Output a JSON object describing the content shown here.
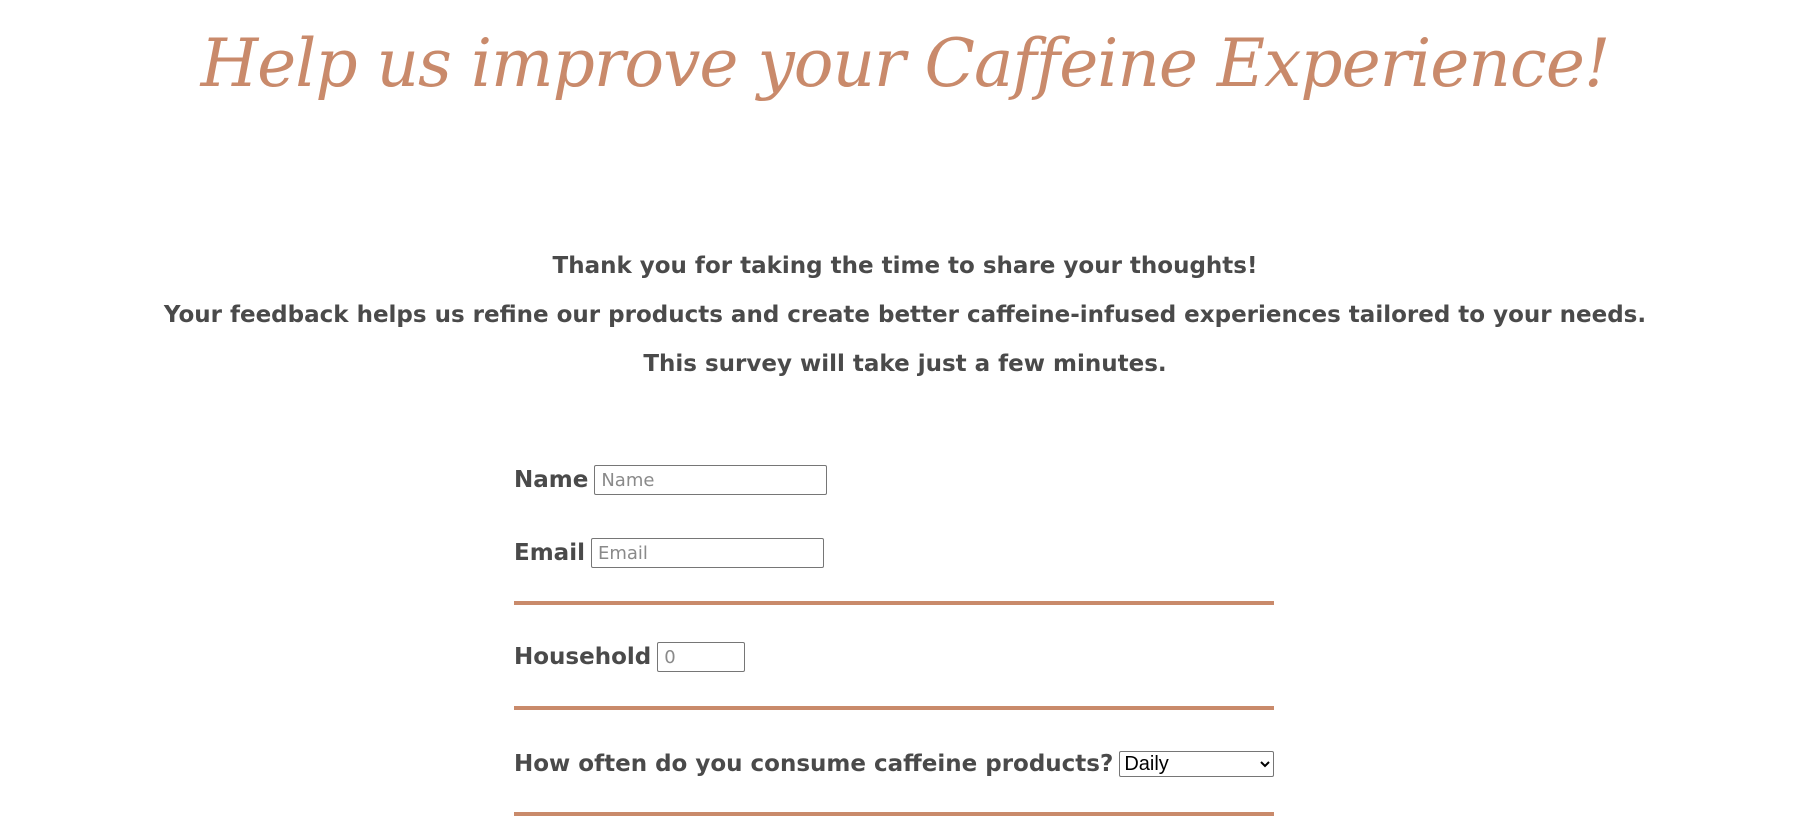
{
  "page": {
    "title": "Help us improve your Caffeine Experience!",
    "accent_color": "#c98a6b",
    "text_color": "#4a4a4a"
  },
  "intro": {
    "line1": "Thank you for taking the time to share your thoughts!",
    "line2": "Your feedback helps us refine our products and create better caffeine-infused experiences tailored to your needs.",
    "line3": "This survey will take just a few minutes."
  },
  "form": {
    "name": {
      "label": "Name",
      "value": "",
      "placeholder": "Name"
    },
    "email": {
      "label": "Email",
      "value": "",
      "placeholder": "Email"
    },
    "household": {
      "label": "Household",
      "value": "",
      "placeholder": "0"
    },
    "frequency": {
      "label": "How often do you consume caffeine products?",
      "selected": "Daily"
    }
  }
}
